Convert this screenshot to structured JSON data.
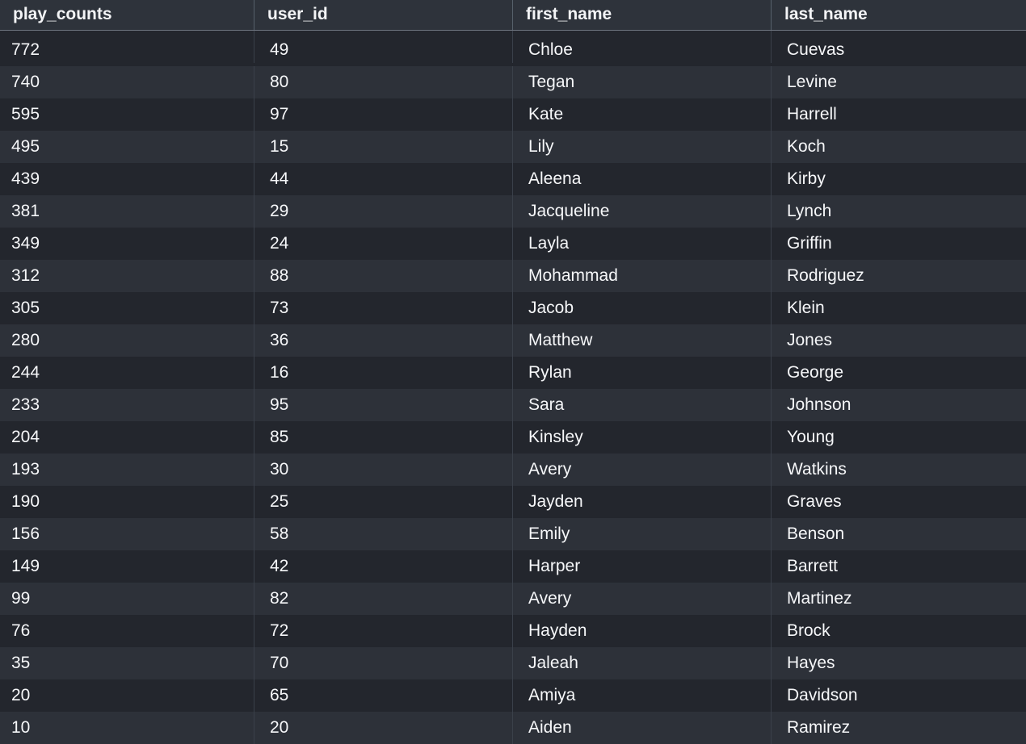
{
  "table": {
    "columns": [
      "play_counts",
      "user_id",
      "first_name",
      "last_name"
    ],
    "rows": [
      [
        "772",
        "49",
        "Chloe",
        "Cuevas"
      ],
      [
        "740",
        "80",
        "Tegan",
        "Levine"
      ],
      [
        "595",
        "97",
        "Kate",
        "Harrell"
      ],
      [
        "495",
        "15",
        "Lily",
        "Koch"
      ],
      [
        "439",
        "44",
        "Aleena",
        "Kirby"
      ],
      [
        "381",
        "29",
        "Jacqueline",
        "Lynch"
      ],
      [
        "349",
        "24",
        "Layla",
        "Griffin"
      ],
      [
        "312",
        "88",
        "Mohammad",
        "Rodriguez"
      ],
      [
        "305",
        "73",
        "Jacob",
        "Klein"
      ],
      [
        "280",
        "36",
        "Matthew",
        "Jones"
      ],
      [
        "244",
        "16",
        "Rylan",
        "George"
      ],
      [
        "233",
        "95",
        "Sara",
        "Johnson"
      ],
      [
        "204",
        "85",
        "Kinsley",
        "Young"
      ],
      [
        "193",
        "30",
        "Avery",
        "Watkins"
      ],
      [
        "190",
        "25",
        "Jayden",
        "Graves"
      ],
      [
        "156",
        "58",
        "Emily",
        "Benson"
      ],
      [
        "149",
        "42",
        "Harper",
        "Barrett"
      ],
      [
        "99",
        "82",
        "Avery",
        "Martinez"
      ],
      [
        "76",
        "72",
        "Hayden",
        "Brock"
      ],
      [
        "35",
        "70",
        "Jaleah",
        "Hayes"
      ],
      [
        "20",
        "65",
        "Amiya",
        "Davidson"
      ],
      [
        "10",
        "20",
        "Aiden",
        "Ramirez"
      ]
    ]
  }
}
